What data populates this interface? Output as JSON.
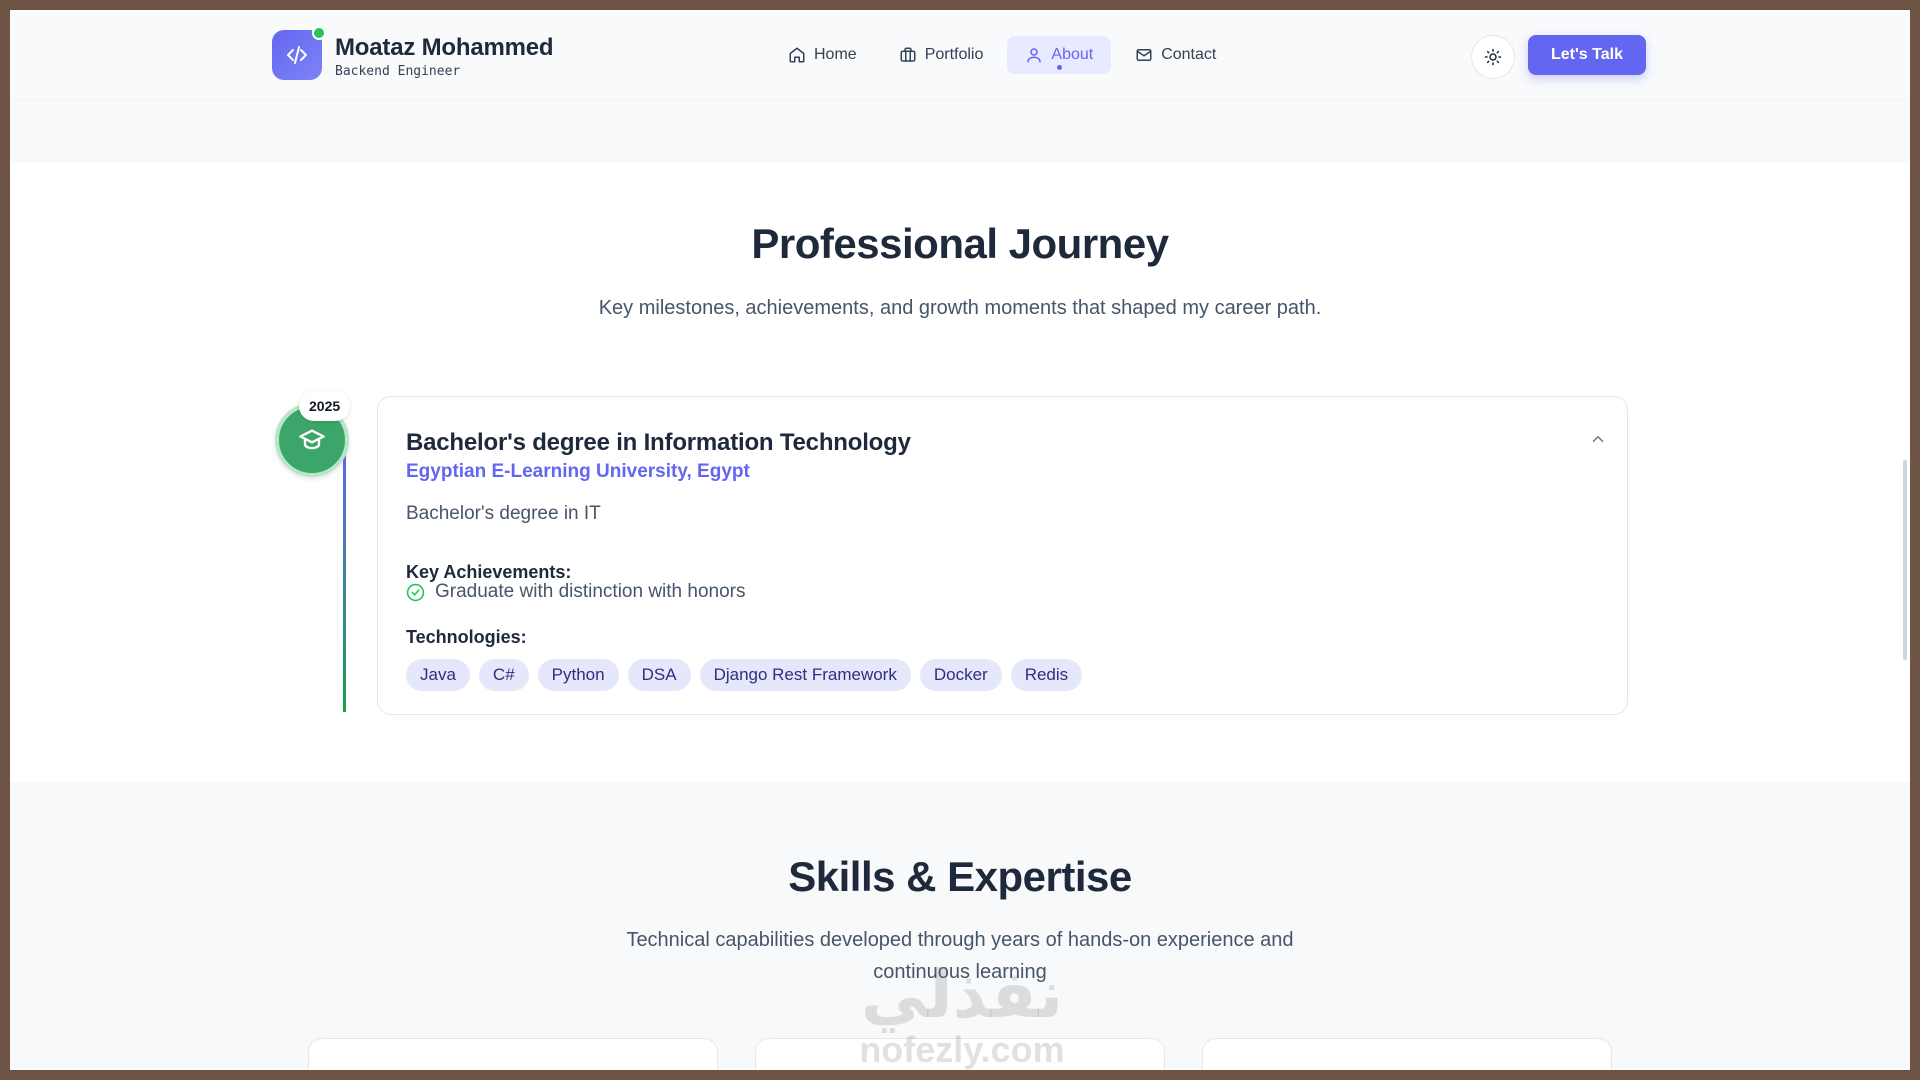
{
  "header": {
    "brand_name": "Moataz Mohammed",
    "brand_subtitle": "Backend Engineer",
    "nav": [
      {
        "label": "Home",
        "icon": "home-icon"
      },
      {
        "label": "Portfolio",
        "icon": "briefcase-icon"
      },
      {
        "label": "About",
        "icon": "user-icon",
        "active": true
      },
      {
        "label": "Contact",
        "icon": "mail-icon"
      }
    ],
    "cta_label": "Let's Talk"
  },
  "journey": {
    "title": "Professional Journey",
    "subtitle": "Key milestones, achievements, and growth moments that shaped my career path.",
    "items": [
      {
        "year": "2025",
        "title": "Bachelor's degree in Information Technology",
        "organization": "Egyptian E-Learning University, Egypt",
        "description": "Bachelor's degree in IT",
        "achievements_heading": "Key Achievements:",
        "achievements": [
          "Graduate with distinction with honors"
        ],
        "technologies_heading": "Technologies:",
        "technologies": [
          "Java",
          "C#",
          "Python",
          "DSA",
          "Django Rest Framework",
          "Docker",
          "Redis"
        ]
      }
    ]
  },
  "skills": {
    "title": "Skills & Expertise",
    "subtitle": "Technical capabilities developed through years of hands-on experience and continuous learning"
  },
  "watermark": {
    "arabic": "نفذلي",
    "latin": "nofezly.com"
  },
  "colors": {
    "accent": "#6366f1",
    "success": "#22c55e",
    "timeline_node": "#3ca66a"
  }
}
